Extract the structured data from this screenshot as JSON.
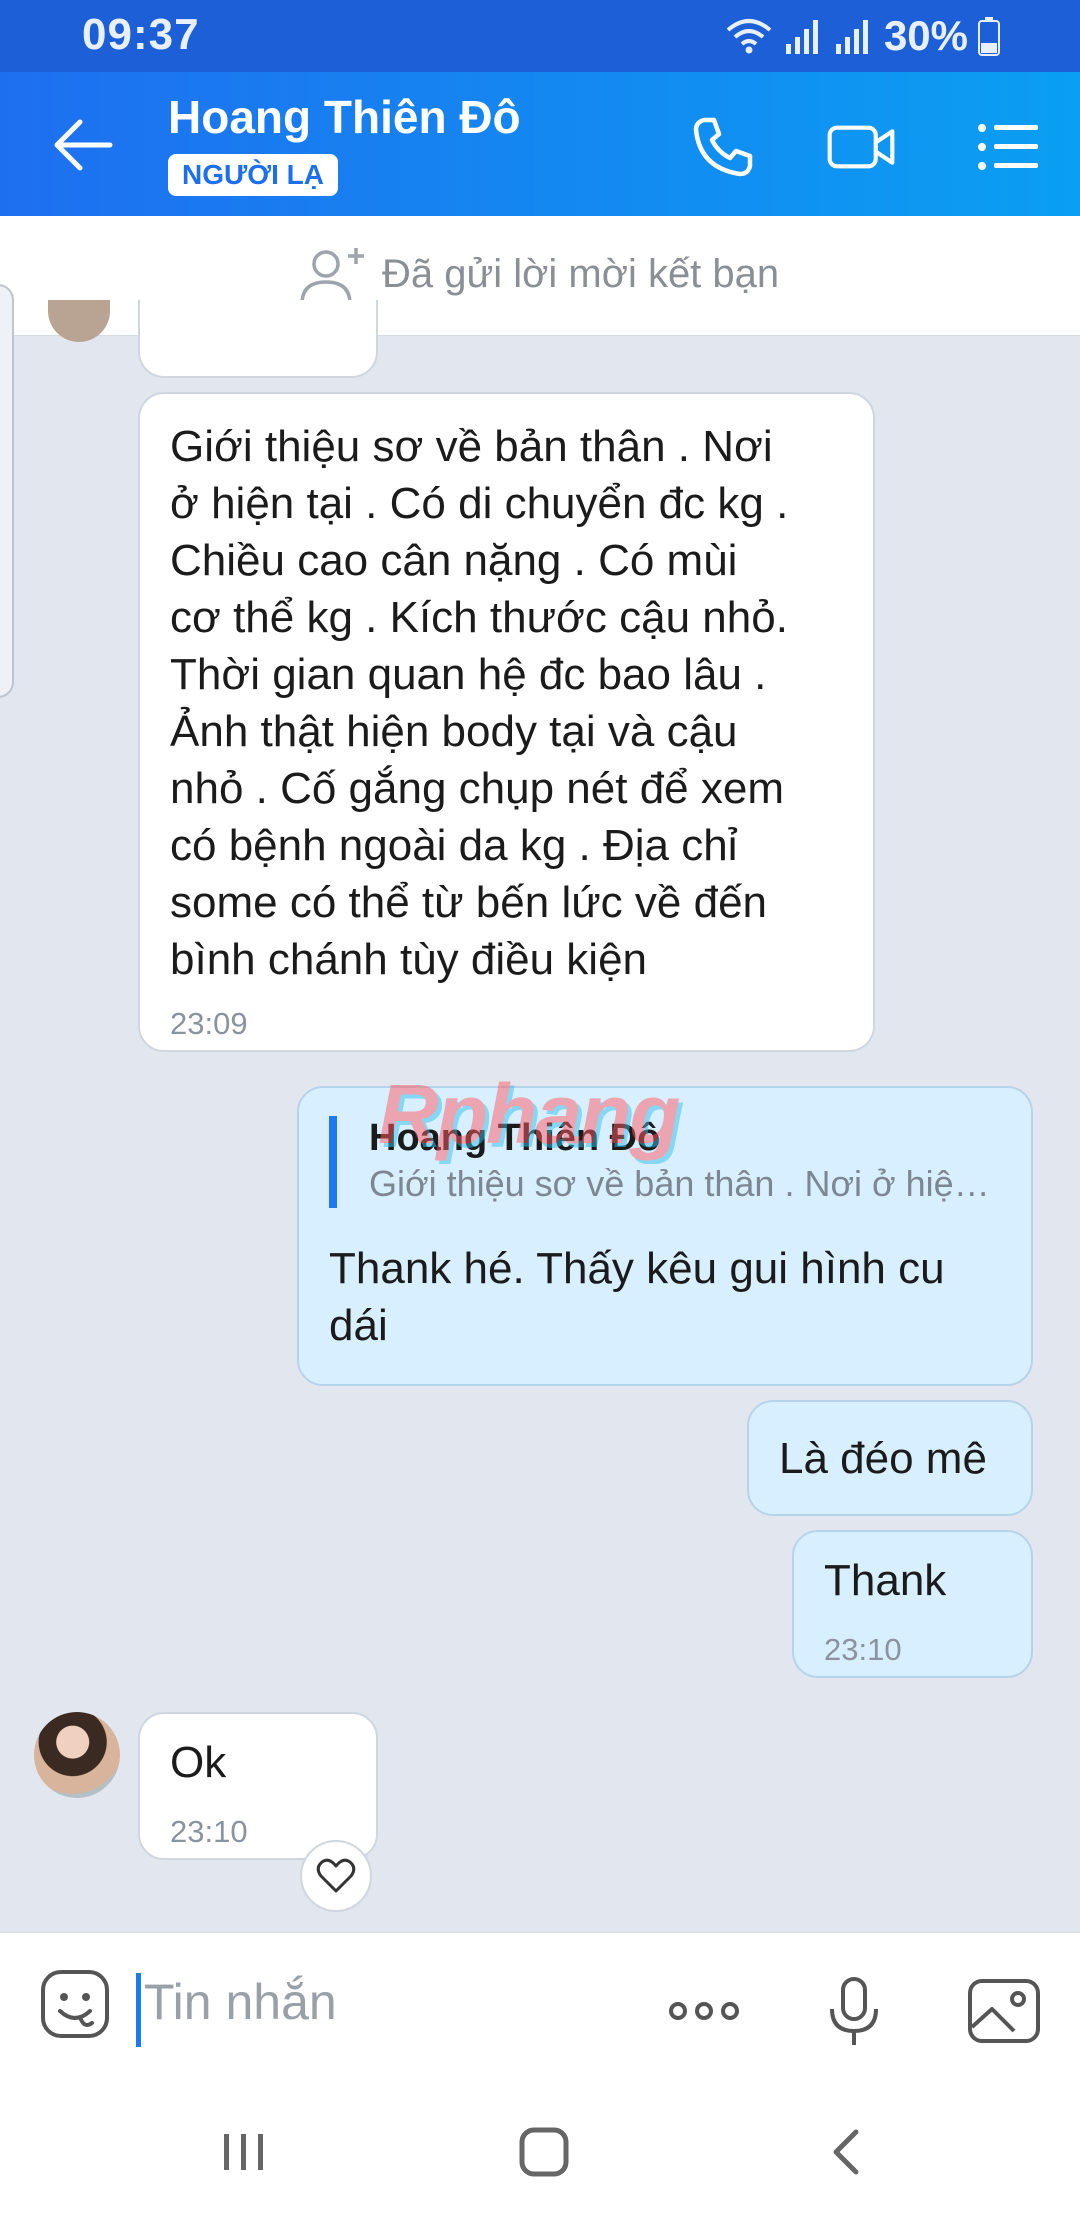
{
  "status_bar": {
    "time": "09:37",
    "battery": "30%"
  },
  "header": {
    "contact_name": "Hoang Thiên Đô",
    "stranger_tag": "NGƯỜI LẠ"
  },
  "info_bar": {
    "text": "Đã gửi lời mời kết bạn"
  },
  "messages": [
    {
      "direction": "in",
      "lines": [
        "Giới thiệu sơ về bản thân . Nơi",
        "ở hiện tại . Có di chuyển đc kg .",
        "Chiều cao cân nặng . Có mùi",
        "cơ thể kg . Kích thước cậu nhỏ.",
        "Thời gian quan hệ đc bao lâu .",
        "Ảnh thật hiện body tại và cậu",
        "nhỏ . Cố gắng chụp nét để xem",
        "có bệnh ngoài da kg . Địa chỉ",
        "some có thể từ bến lức về đến",
        "bình chánh tùy điều kiện"
      ],
      "time": "23:09"
    },
    {
      "direction": "out",
      "quote_name": "Hoang Thiên Đô",
      "quote_text": "Giới thiệu sơ về bản thân . Nơi ở hiệ…",
      "lines": [
        "Thank hé. Thấy kêu gui hình cu",
        "dái"
      ]
    },
    {
      "direction": "out",
      "text": "Là đéo mê"
    },
    {
      "direction": "out",
      "text": "Thank",
      "time": "23:10"
    },
    {
      "direction": "in",
      "text": "Ok",
      "time": "23:10"
    }
  ],
  "watermark": "Rphang",
  "composer": {
    "placeholder": "Tin nhắn"
  },
  "icons": {
    "back": "arrow-left-icon",
    "call": "phone-icon",
    "video": "video-camera-icon",
    "menu": "list-menu-icon",
    "add_friend": "add-person-icon",
    "sticker": "sticker-face-icon",
    "more": "more-dots-icon",
    "mic": "microphone-icon",
    "gallery": "image-icon",
    "reaction": "heart-icon"
  },
  "colors": {
    "header": "#1e6ff0",
    "accent": "#1e7af0",
    "outgoing_bubble": "#d8efff",
    "incoming_bubble": "#ffffff",
    "chat_bg": "#e2e7ef"
  }
}
